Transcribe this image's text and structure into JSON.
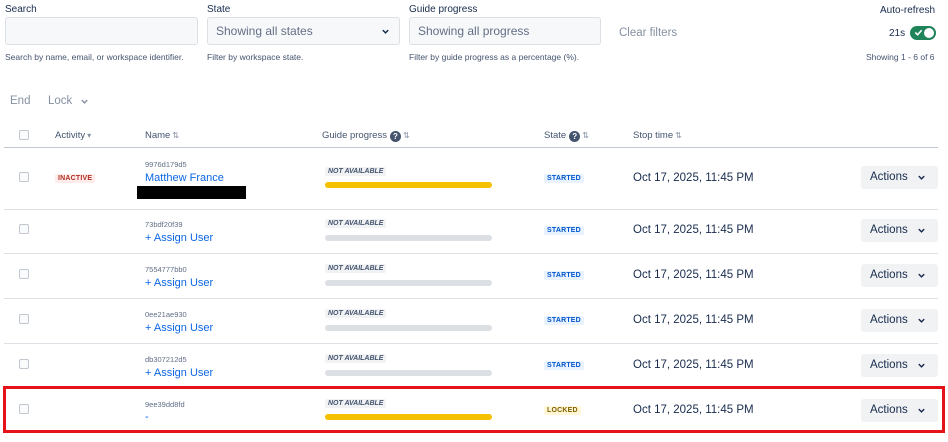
{
  "filters": {
    "search": {
      "label": "Search",
      "value": "",
      "hint": "Search by name, email, or workspace identifier."
    },
    "state": {
      "label": "State",
      "value": "Showing all states",
      "hint": "Filter by workspace state."
    },
    "guide_progress": {
      "label": "Guide progress",
      "value": "Showing all progress",
      "hint": "Filter by guide progress as a percentage (%)."
    },
    "clear_label": "Clear filters"
  },
  "auto_refresh": {
    "label": "Auto-refresh",
    "countdown": "21s",
    "enabled": true,
    "showing": "Showing 1 - 6 of 6"
  },
  "toolbar": {
    "end_label": "End",
    "lock_label": "Lock"
  },
  "columns": {
    "activity": "Activity",
    "name": "Name",
    "guide_progress": "Guide progress",
    "state": "State",
    "stop_time": "Stop time"
  },
  "rows": [
    {
      "activity": "INACTIVE",
      "id": "9976d179d5",
      "name": "Matthew France",
      "redacted": true,
      "progress_label": "NOT AVAILABLE",
      "progress_fraction": 1.0,
      "state": "STARTED",
      "stop_time": "Oct 17, 2025, 11:45 PM",
      "actions": "Actions"
    },
    {
      "activity": "",
      "id": "73bdf20f39",
      "name": "+ Assign User",
      "redacted": false,
      "progress_label": "NOT AVAILABLE",
      "progress_fraction": 0.0,
      "state": "STARTED",
      "stop_time": "Oct 17, 2025, 11:45 PM",
      "actions": "Actions"
    },
    {
      "activity": "",
      "id": "7554777bb0",
      "name": "+ Assign User",
      "redacted": false,
      "progress_label": "NOT AVAILABLE",
      "progress_fraction": 0.0,
      "state": "STARTED",
      "stop_time": "Oct 17, 2025, 11:45 PM",
      "actions": "Actions"
    },
    {
      "activity": "",
      "id": "0ee21ae930",
      "name": "+ Assign User",
      "redacted": false,
      "progress_label": "NOT AVAILABLE",
      "progress_fraction": 0.0,
      "state": "STARTED",
      "stop_time": "Oct 17, 2025, 11:45 PM",
      "actions": "Actions"
    },
    {
      "activity": "",
      "id": "db307212d5",
      "name": "+ Assign User",
      "redacted": false,
      "progress_label": "NOT AVAILABLE",
      "progress_fraction": 0.0,
      "state": "STARTED",
      "stop_time": "Oct 17, 2025, 11:45 PM",
      "actions": "Actions"
    },
    {
      "activity": "",
      "id": "9ee39dd8fd",
      "name": "-",
      "redacted": false,
      "progress_label": "NOT AVAILABLE",
      "progress_fraction": 1.0,
      "state": "LOCKED",
      "stop_time": "Oct 17, 2025, 11:45 PM",
      "actions": "Actions"
    }
  ],
  "colors": {
    "accent": "#0c66e4",
    "toggle": "#1f845a",
    "progress_fill": "#f5c000",
    "highlight": "#e5121a"
  },
  "icons": {
    "dropdown": "chevron-down-icon",
    "help": "help-icon",
    "toggle_check": "check-icon"
  }
}
